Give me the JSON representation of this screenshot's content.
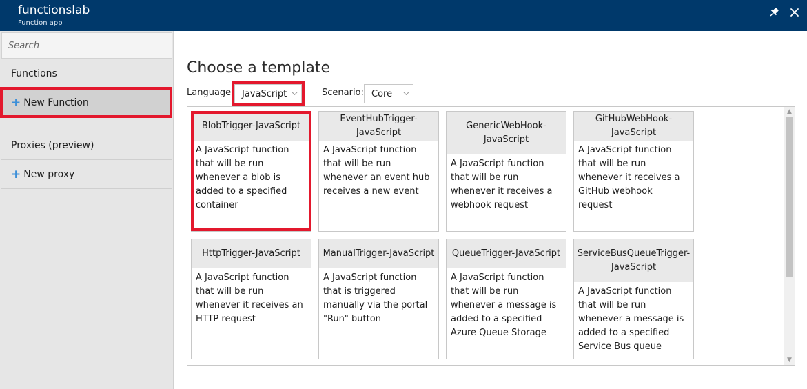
{
  "header": {
    "title": "functionslab",
    "subtitle": "Function app",
    "pin_icon": "pin-icon",
    "close_icon": "close-icon",
    "background": "#00396b"
  },
  "sidebar": {
    "search_placeholder": "Search",
    "items": [
      {
        "label": "Functions",
        "kind": "header"
      },
      {
        "label": "New Function",
        "kind": "action",
        "icon": "plus-icon",
        "selected": true
      },
      {
        "label": "Proxies (preview)",
        "kind": "header"
      },
      {
        "label": "New proxy",
        "kind": "action",
        "icon": "plus-icon"
      }
    ]
  },
  "main": {
    "title": "Choose a template",
    "language_label": "Language:",
    "language_value": "JavaScript",
    "scenario_label": "Scenario:",
    "scenario_value": "Core",
    "templates": [
      {
        "name": "BlobTrigger-JavaScript",
        "description": "A JavaScript function that will be run whenever a blob is added to a specified container"
      },
      {
        "name": "EventHubTrigger-JavaScript",
        "description": "A JavaScript function that will be run whenever an event hub receives a new event"
      },
      {
        "name": "GenericWebHook-JavaScript",
        "description": "A JavaScript function that will be run whenever it receives a webhook request"
      },
      {
        "name": "GitHubWebHook-JavaScript",
        "description": "A JavaScript function that will be run whenever it receives a GitHub webhook request"
      },
      {
        "name": "HttpTrigger-JavaScript",
        "description": "A JavaScript function that will be run whenever it receives an HTTP request"
      },
      {
        "name": "ManualTrigger-JavaScript",
        "description": "A JavaScript function that is triggered manually via the portal \"Run\" button"
      },
      {
        "name": "QueueTrigger-JavaScript",
        "description": "A JavaScript function that will be run whenever a message is added to a specified Azure Queue Storage"
      },
      {
        "name": "ServiceBusQueueTrigger-JavaScript",
        "description": "A JavaScript function that will be run whenever a message is added to a specified Service Bus queue"
      }
    ]
  },
  "colors": {
    "accent_blue": "#3c8fd8",
    "highlight_red": "#e3182d"
  }
}
